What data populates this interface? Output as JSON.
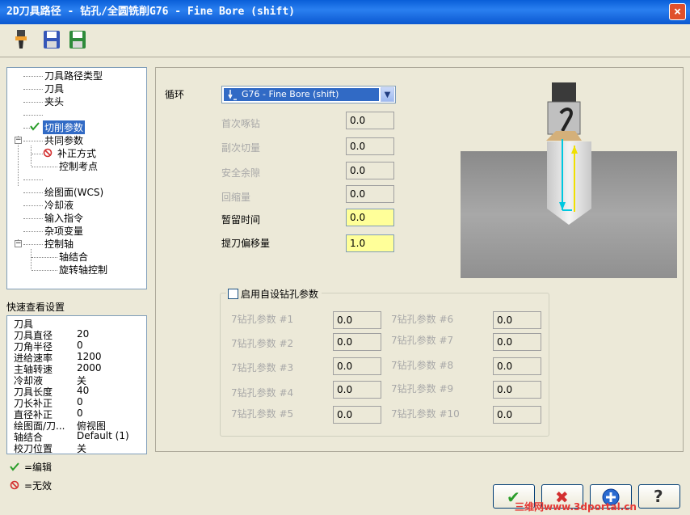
{
  "window": {
    "title": "2D刀具路径 - 钻孔/全圆铣削G76 - Fine Bore (shift)",
    "close_glyph": "×"
  },
  "tree": {
    "items": [
      {
        "label": "刀具路径类型"
      },
      {
        "label": "刀具"
      },
      {
        "label": "夹头"
      },
      {
        "label": ""
      },
      {
        "label": "切削参数",
        "state": "edited",
        "selected": true
      },
      {
        "label": "共同参数"
      },
      {
        "label": "补正方式",
        "state": "disabled"
      },
      {
        "label": "控制考点"
      },
      {
        "label": ""
      },
      {
        "label": "绘图面(WCS)"
      },
      {
        "label": "冷却液"
      },
      {
        "label": "输入指令"
      },
      {
        "label": "杂项变量"
      },
      {
        "label": "控制轴"
      },
      {
        "label": "轴结合"
      },
      {
        "label": "旋转轴控制"
      }
    ]
  },
  "quick_view": {
    "title": "快速查看设置",
    "rows": [
      {
        "key": "刀具",
        "value": ""
      },
      {
        "key": "刀具直径",
        "value": "20"
      },
      {
        "key": "刀角半径",
        "value": "0"
      },
      {
        "key": "进给速率",
        "value": "1200"
      },
      {
        "key": "主轴转速",
        "value": "2000"
      },
      {
        "key": "冷却液",
        "value": "关"
      },
      {
        "key": "刀具长度",
        "value": "40"
      },
      {
        "key": "刀长补正",
        "value": "0"
      },
      {
        "key": "直径补正",
        "value": "0"
      },
      {
        "key": "绘图面/刀...",
        "value": "俯视图"
      },
      {
        "key": "轴结合",
        "value": "Default (1)"
      },
      {
        "key": "校刀位置",
        "value": "关"
      }
    ]
  },
  "legend": {
    "edit": "=编辑",
    "invalid": "=无效"
  },
  "cycle": {
    "label": "循环",
    "selected": "G76 - Fine Bore (shift)"
  },
  "params": [
    {
      "label": "首次啄钻",
      "value": "0.0",
      "enabled": false
    },
    {
      "label": "副次切量",
      "value": "0.0",
      "enabled": false
    },
    {
      "label": "安全余隙",
      "value": "0.0",
      "enabled": false
    },
    {
      "label": "回缩量",
      "value": "0.0",
      "enabled": false
    },
    {
      "label": "暂留时间",
      "value": "0.0",
      "enabled": true
    },
    {
      "label": "提刀偏移量",
      "value": "1.0",
      "enabled": true
    }
  ],
  "custom": {
    "checkbox_label": "启用自设钻孔参数",
    "checked": false,
    "left": [
      {
        "label": "7钻孔参数 #1",
        "value": "0.0"
      },
      {
        "label": "7钻孔参数 #2",
        "value": "0.0"
      },
      {
        "label": "7钻孔参数 #3",
        "value": "0.0"
      },
      {
        "label": "7钻孔参数 #4",
        "value": "0.0"
      },
      {
        "label": "7钻孔参数 #5",
        "value": "0.0"
      }
    ],
    "right": [
      {
        "label": "7钻孔参数 #6",
        "value": "0.0"
      },
      {
        "label": "7钻孔参数 #7",
        "value": "0.0"
      },
      {
        "label": "7钻孔参数 #8",
        "value": "0.0"
      },
      {
        "label": "7钻孔参数 #9",
        "value": "0.0"
      },
      {
        "label": "7钻孔参数 #10",
        "value": "0.0"
      }
    ]
  },
  "buttons": {
    "ok_glyph": "✔",
    "cancel_glyph": "✖",
    "help_glyph": "?"
  },
  "watermark": "三维网www.3dportal.cn",
  "colors": {
    "title_blue": "#0a5fd8",
    "selection_blue": "#316ac5",
    "highlight_yellow": "#ffff99",
    "check_green": "#2a9d2a",
    "forbid_red": "#d32f2f"
  }
}
